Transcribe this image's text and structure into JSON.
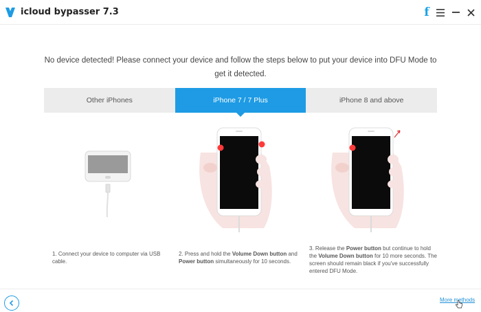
{
  "app": {
    "title": "icloud bypasser 7.3",
    "facebook_glyph": "f",
    "accent_color": "#1e9be4"
  },
  "instruction": {
    "text": "No device detected! Please connect your device and follow the steps below to put your device into DFU Mode to get it detected."
  },
  "tabs": [
    {
      "label": "Other iPhones",
      "active": false
    },
    {
      "label": "iPhone 7 / 7 Plus",
      "active": true
    },
    {
      "label": "iPhone 8 and above",
      "active": false
    }
  ],
  "steps": [
    {
      "prefix": "1. Connect your device to computer via USB cable.",
      "bold1": "",
      "mid": "",
      "bold2": "",
      "suffix": ""
    },
    {
      "prefix": "2. Press and hold the ",
      "bold1": "Volume Down button",
      "mid": " and ",
      "bold2": "Power button",
      "suffix": " simultaneously for 10 seconds."
    },
    {
      "prefix": "3. Release the ",
      "bold1": "Power button",
      "mid": " but continue to hold the ",
      "bold2": "Volume Down button",
      "suffix": " for 10 more seconds. The screen should remain black if you've successfully entered DFU Mode."
    }
  ],
  "footer": {
    "more_methods": "More methods"
  },
  "icons": {
    "logo": "app-logo-icon",
    "facebook": "facebook-icon",
    "menu": "menu-icon",
    "minimize": "minimize-icon",
    "close": "close-icon",
    "back": "back-arrow-icon"
  }
}
